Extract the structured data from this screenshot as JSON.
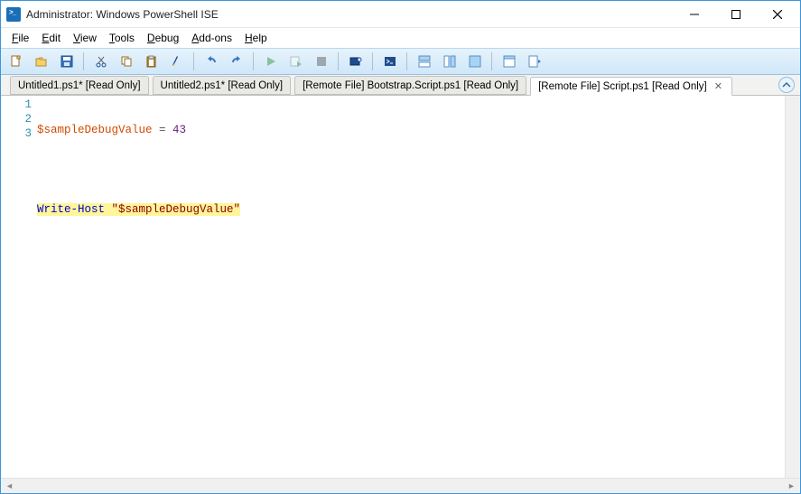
{
  "window": {
    "title": "Administrator: Windows PowerShell ISE"
  },
  "menu": {
    "file": "File",
    "edit": "Edit",
    "view": "View",
    "tools": "Tools",
    "debug": "Debug",
    "addons": "Add-ons",
    "help": "Help"
  },
  "tabs": [
    {
      "label": "Untitled1.ps1* [Read Only]",
      "active": false
    },
    {
      "label": "Untitled2.ps1* [Read Only]",
      "active": false
    },
    {
      "label": "[Remote File] Bootstrap.Script.ps1 [Read Only]",
      "active": false
    },
    {
      "label": "[Remote File] Script.ps1 [Read Only]",
      "active": true
    }
  ],
  "code": {
    "lines": [
      "1",
      "2",
      "3"
    ],
    "line1": {
      "var": "$sampleDebugValue",
      "op": " = ",
      "num": "43"
    },
    "line3": {
      "cmd": "Write-Host",
      "sp": " ",
      "str": "\"$sampleDebugValue\""
    }
  }
}
